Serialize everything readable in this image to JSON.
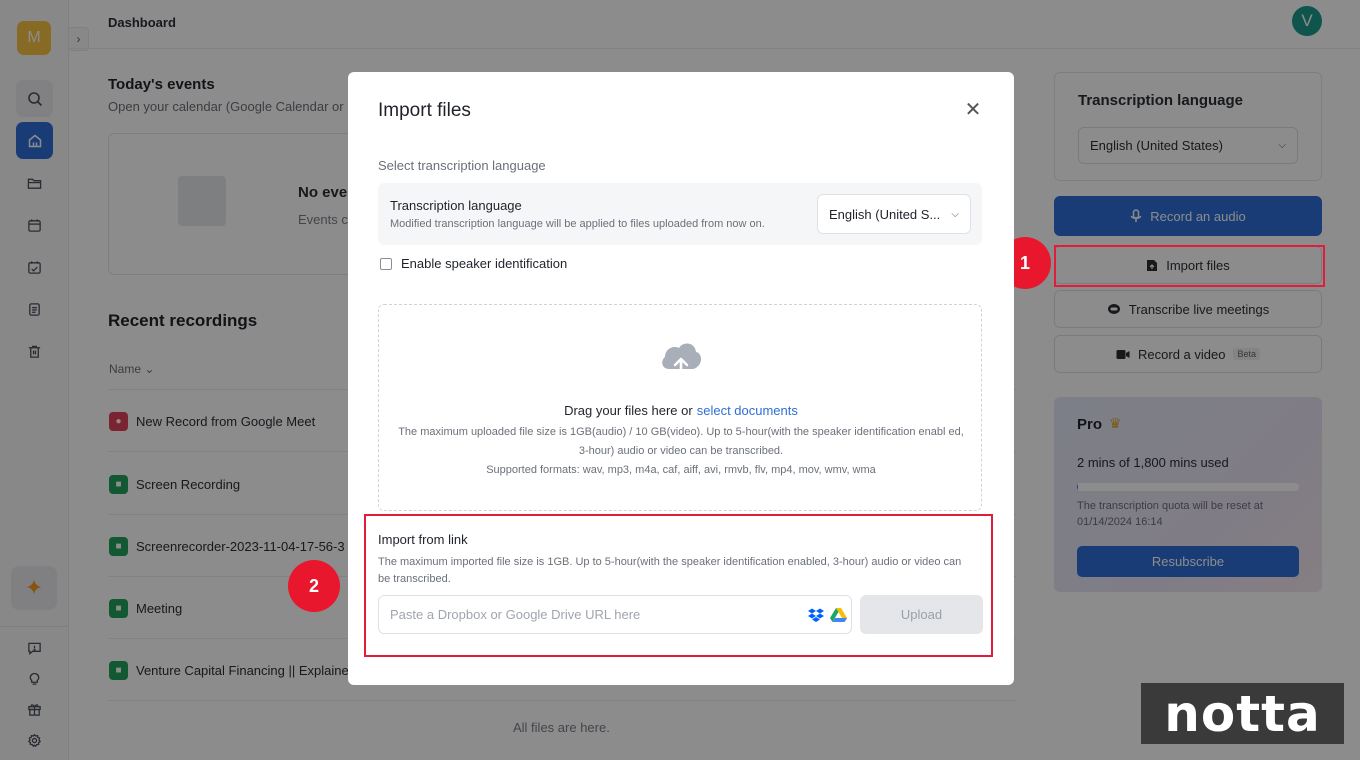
{
  "sidebar": {
    "logo_letter": "M",
    "ai_glyph": "✦"
  },
  "header": {
    "title": "Dashboard",
    "avatar_letter": "V"
  },
  "events": {
    "title": "Today's events",
    "subtitle": "Open your calendar (Google Calendar or",
    "empty_title": "No eve",
    "empty_sub": "Events c"
  },
  "recent": {
    "title": "Recent recordings",
    "column_name": "Name",
    "rows": [
      {
        "name": "New Record from Google Meet",
        "icon": "google-meet-icon"
      },
      {
        "name": "Screen Recording",
        "icon": "file-icon"
      },
      {
        "name": "Screenrecorder-2023-11-04-17-56-3",
        "icon": "file-icon"
      },
      {
        "name": "Meeting",
        "icon": "file-icon"
      },
      {
        "name": "Venture Capital Financing || Explaine",
        "icon": "file-icon"
      }
    ],
    "footer": "All files are here."
  },
  "right_panel": {
    "lang_title": "Transcription language",
    "lang_value": "English (United States)",
    "record_audio": "Record an audio",
    "import_files": "Import files",
    "transcribe_live": "Transcribe live meetings",
    "record_video": "Record a video",
    "beta": "Beta",
    "pro": {
      "title": "Pro",
      "usage": "2 mins of 1,800 mins used",
      "used_fraction": 0.0011,
      "reset_text": "The transcription quota will be reset at 01/14/2024 16:14",
      "button": "Resubscribe"
    }
  },
  "modal": {
    "title": "Import files",
    "section_label": "Select transcription language",
    "lang_title": "Transcription language",
    "lang_sub": "Modified transcription language will be applied to files uploaded from now on.",
    "lang_value": "English (United S...",
    "speaker_label": "Enable speaker identification",
    "drag_text": "Drag your files here or",
    "select_link": "select documents",
    "drop_info_1": "The maximum uploaded file size is 1GB(audio) / 10 GB(video). Up to 5-hour(with the speaker identification enabl ed, 3-hour) audio or video can be transcribed.",
    "drop_info_2": "Supported formats: wav, mp3, m4a, caf, aiff, avi, rmvb, flv, mp4, mov, wmv, wma",
    "link_title": "Import from link",
    "link_desc": "The maximum imported file size is 1GB. Up to 5-hour(with the speaker identification enabled, 3-hour) audio or video can be transcribed.",
    "url_placeholder": "Paste a Dropbox or Google Drive URL here",
    "upload": "Upload"
  },
  "annotations": {
    "step1": "1",
    "step2": "2",
    "highlight_color": "#e01e3c"
  },
  "watermark": "notta",
  "colors": {
    "accent": "#2f6ed8",
    "logo": "#f6c343",
    "avatar": "#1c9a8c"
  }
}
